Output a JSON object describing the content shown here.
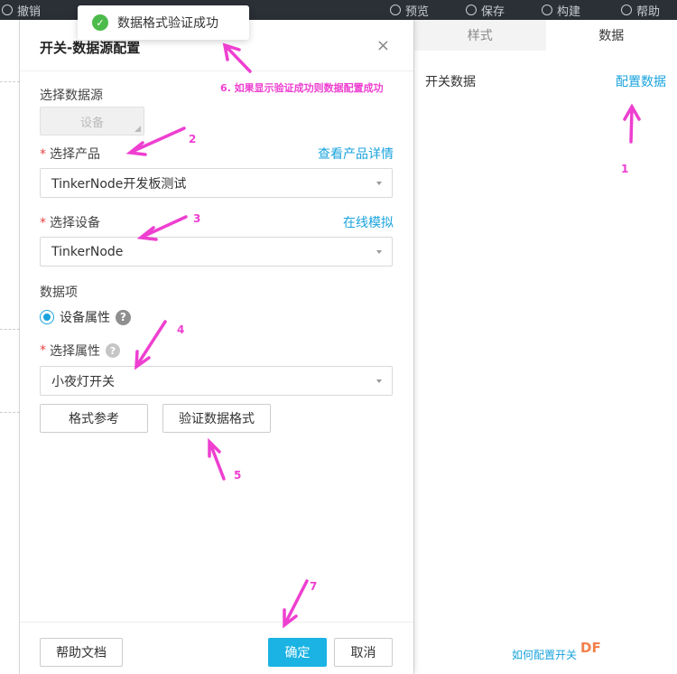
{
  "topbar": {
    "items": [
      "撤销",
      "预览",
      "保存",
      "构建",
      "帮助"
    ]
  },
  "dialog": {
    "title": "开关-数据源配置",
    "close": "×",
    "source_label": "选择数据源",
    "source_value": "设备",
    "product_label": "选择产品",
    "product_link": "查看产品详情",
    "product_value": "TinkerNode开发板测试",
    "device_label": "选择设备",
    "device_link": "在线模拟",
    "device_value": "TinkerNode",
    "data_item_label": "数据项",
    "radio_label": "设备属性",
    "property_label": "选择属性",
    "property_value": "小夜灯开关",
    "format_button": "格式参考",
    "verify_button": "验证数据格式",
    "help_button": "帮助文档",
    "ok_button": "确定",
    "cancel_button": "取消",
    "help_icon": "?"
  },
  "toast": {
    "text": "数据格式验证成功",
    "icon": "✓"
  },
  "right_panel": {
    "tabs": [
      "样式",
      "数据"
    ],
    "switch_label": "开关数据",
    "config_link": "配置数据",
    "help_link": "如何配置开关",
    "watermark": "DF"
  },
  "annotations": {
    "a1": "1",
    "a2": "2",
    "a3": "3",
    "a4": "4",
    "a5": "5",
    "a6": "6. 如果显示验证成功则数据配置成功",
    "a7": "7",
    "color": "#ee3fd0"
  },
  "colors": {
    "accent": "#1aa3dc",
    "primary_button": "#1ab3e3",
    "required": "#e54545",
    "success": "#4cbb4c"
  }
}
